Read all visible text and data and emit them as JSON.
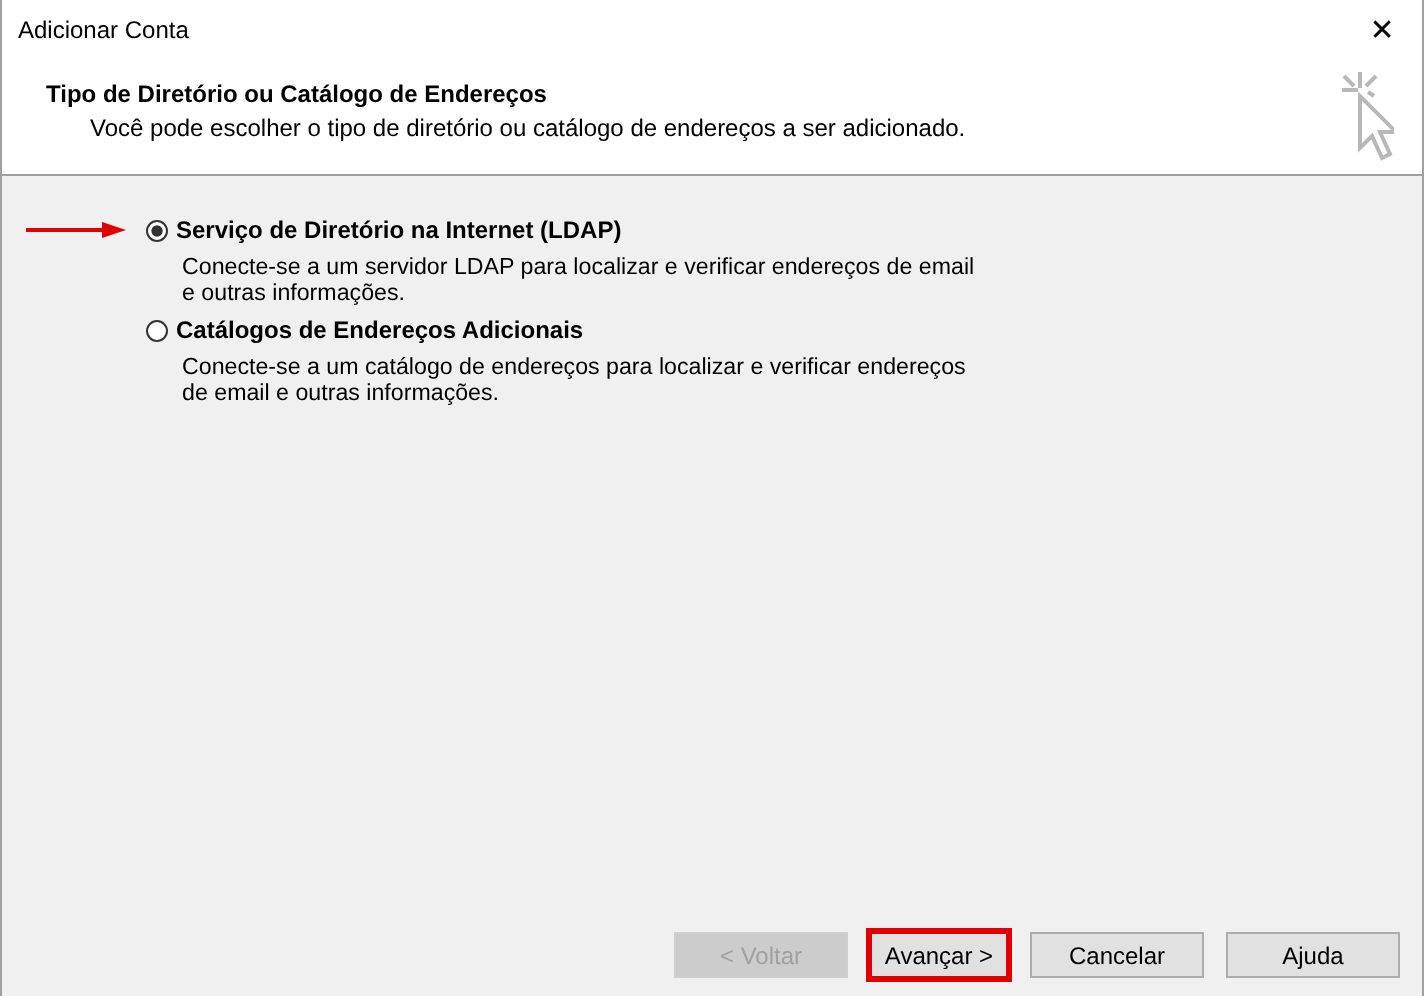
{
  "window": {
    "title": "Adicionar Conta",
    "close": "✕"
  },
  "header": {
    "title": "Tipo de Diretório ou Catálogo de Endereços",
    "subtitle": "Você pode escolher o tipo de diretório ou catálogo de endereços a ser adicionado."
  },
  "options": [
    {
      "label": "Serviço de Diretório na Internet (LDAP)",
      "description": "Conecte-se a um servidor LDAP para localizar e verificar endereços de email e outras informações.",
      "selected": true,
      "pointed": true
    },
    {
      "label": "Catálogos de Endereços Adicionais",
      "description": "Conecte-se a um catálogo de endereços para localizar e verificar endereços de email e outras informações.",
      "selected": false,
      "pointed": false
    }
  ],
  "buttons": [
    {
      "label": "< Voltar",
      "disabled": true,
      "highlighted": false
    },
    {
      "label": "Avançar >",
      "disabled": false,
      "highlighted": true
    },
    {
      "label": "Cancelar",
      "disabled": false,
      "highlighted": false
    },
    {
      "label": "Ajuda",
      "disabled": false,
      "highlighted": false
    }
  ]
}
